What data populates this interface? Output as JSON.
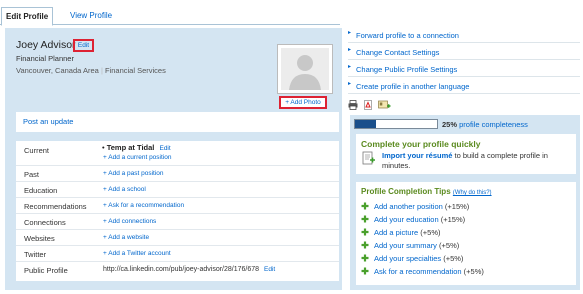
{
  "tabs": {
    "active": "Edit Profile",
    "other": "View Profile"
  },
  "profile": {
    "name": "Joey Advisor",
    "edit_label": "Edit",
    "headline": "Financial Planner",
    "location": "Vancouver, Canada Area",
    "industry": "Financial Services",
    "add_photo": "+ Add Photo",
    "post_update": "Post an update"
  },
  "sections": {
    "current_label": "Current",
    "current_bullet": "•",
    "current_value": "Temp at Tidal",
    "current_edit": "Edit",
    "current_add": "+ Add a current position",
    "rows": [
      {
        "label": "Past",
        "value": "+ Add a past position"
      },
      {
        "label": "Education",
        "value": "+ Add a school"
      },
      {
        "label": "Recommendations",
        "value": "+ Ask for a recommendation"
      },
      {
        "label": "Connections",
        "value": "+ Add connections"
      },
      {
        "label": "Websites",
        "value": "+ Add a website"
      },
      {
        "label": "Twitter",
        "value": "+ Add a Twitter account"
      }
    ],
    "public_label": "Public Profile",
    "public_url": "http://ca.linkedin.com/pub/joey-advisor/28/176/678",
    "public_edit": "Edit"
  },
  "actions": [
    "Forward profile to a connection",
    "Change Contact Settings",
    "Change Public Profile Settings",
    "Create profile in another language"
  ],
  "action_arrow": "▸",
  "tool_icons": [
    "print-icon",
    "pdf-icon",
    "vcard-icon"
  ],
  "completeness": {
    "percent": 25,
    "percent_text": "25%",
    "label": "profile completeness"
  },
  "quick": {
    "title": "Complete your profile quickly",
    "link": "Import your résumé",
    "rest": "to build a complete profile in minutes."
  },
  "tips": {
    "title": "Profile Completion Tips",
    "why": "(Why do this?)",
    "items": [
      {
        "text": "Add another position",
        "pct": "(+15%)"
      },
      {
        "text": "Add your education",
        "pct": "(+15%)"
      },
      {
        "text": "Add a picture",
        "pct": "(+5%)"
      },
      {
        "text": "Add your summary",
        "pct": "(+5%)"
      },
      {
        "text": "Add your specialties",
        "pct": "(+5%)"
      },
      {
        "text": "Ask for a recommendation",
        "pct": "(+5%)"
      }
    ]
  },
  "colors": {
    "panel_bg": "#d4e5f2",
    "link": "#0066cc",
    "highlight_box": "#dd2233",
    "tips_heading": "#5a8a1e",
    "progress_fill": "#1a4f8b"
  }
}
